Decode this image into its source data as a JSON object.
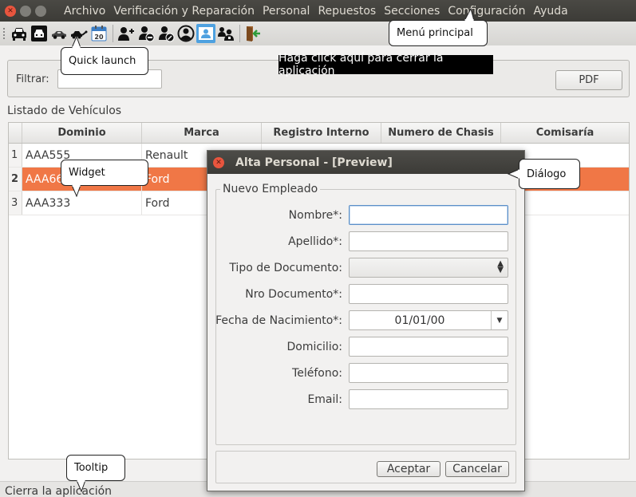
{
  "menubar": {
    "items": [
      "Archivo",
      "Verificación y Reparación",
      "Personal",
      "Repuestos",
      "Secciones",
      "Configuración",
      "Ayuda"
    ]
  },
  "toolbar": {
    "icons": [
      "car-front-icon",
      "car-front-dark-icon",
      "car-side-icon",
      "car-tow-icon",
      "calendar-icon",
      "user-add-icon",
      "user-remove-icon",
      "user-edit-icon",
      "user-circle-icon",
      "user-card-icon",
      "users-group-icon",
      "exit-door-icon"
    ],
    "calendar_day": "20"
  },
  "filter": {
    "label": "Filtrar:",
    "value": "",
    "pdf_label": "PDF"
  },
  "list_title": "Listado de Vehículos",
  "table": {
    "columns": [
      "Dominio",
      "Marca",
      "Registro Interno",
      "Numero de Chasis",
      "Comisaría"
    ],
    "rows": [
      {
        "index": "1",
        "dominio": "AAA555",
        "marca": "Renault"
      },
      {
        "index": "2",
        "dominio": "AAA66",
        "marca": "Ford"
      },
      {
        "index": "3",
        "dominio": "AAA333",
        "marca": "Ford"
      }
    ]
  },
  "status_text": "Cierra la aplicación",
  "dialog": {
    "title": "Alta Personal - [Preview]",
    "group_title": "Nuevo Empleado",
    "fields": {
      "nombre": "Nombre*:",
      "apellido": "Apellido*:",
      "tipo_documento": "Tipo de Documento:",
      "nro_documento": "Nro Documento*:",
      "fecha_nacimiento": "Fecha de Nacimiento*:",
      "domicilio": "Domicilio:",
      "telefono": "Teléfono:",
      "email": "Email:"
    },
    "fecha_value": "01/01/00",
    "accept_label": "Aceptar",
    "cancel_label": "Cancelar"
  },
  "callouts": {
    "menu": "Menú principal",
    "quick": "Quick launch",
    "close_tip": "Haga click aquí para cerrar la aplicación",
    "widget": "Widget",
    "dialog": "Diálogo",
    "tooltip": "Tooltip"
  },
  "colors": {
    "selection": "#f07746",
    "title_bar": "#3c3b37",
    "close_button": "#e8553e",
    "toolbar_highlight": "#4ea1e0"
  }
}
